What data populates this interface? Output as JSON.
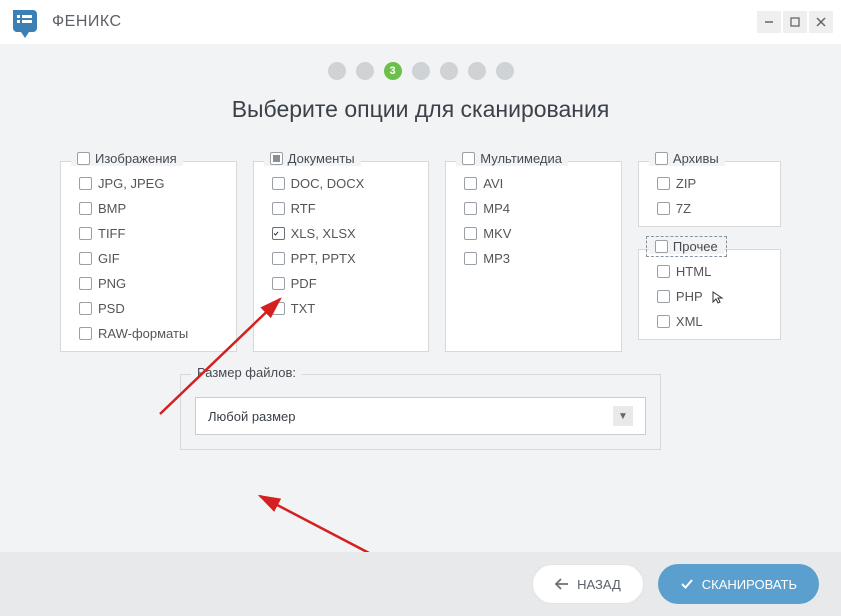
{
  "app": {
    "title": "ФЕНИКС"
  },
  "wizard": {
    "active_step": "3"
  },
  "heading": "Выберите опции для сканирования",
  "groups": {
    "images": {
      "title": "Изображения",
      "items": [
        "JPG, JPEG",
        "BMP",
        "TIFF",
        "GIF",
        "PNG",
        "PSD",
        "RAW-форматы"
      ]
    },
    "documents": {
      "title": "Документы",
      "items": [
        "DOC, DOCX",
        "RTF",
        "XLS, XLSX",
        "PPT, PPTX",
        "PDF",
        "TXT"
      ]
    },
    "multimedia": {
      "title": "Мультимедиа",
      "items": [
        "AVI",
        "MP4",
        "MKV",
        "MP3"
      ]
    },
    "archives": {
      "title": "Архивы",
      "items": [
        "ZIP",
        "7Z"
      ]
    },
    "other": {
      "title": "Прочее",
      "items": [
        "HTML",
        "PHP",
        "XML"
      ]
    }
  },
  "size": {
    "label": "Размер файлов:",
    "selected": "Любой размер"
  },
  "buttons": {
    "back": "НАЗАД",
    "scan": "СКАНИРОВАТЬ"
  }
}
